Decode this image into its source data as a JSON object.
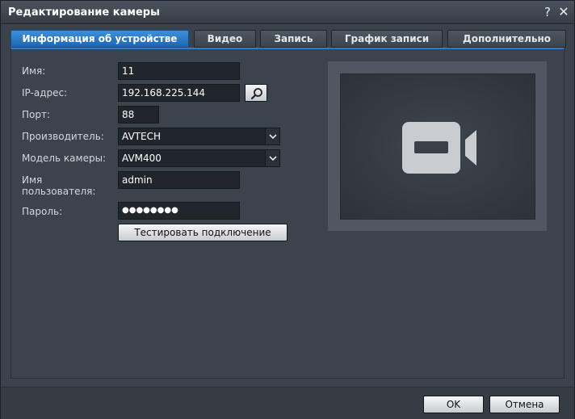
{
  "window": {
    "title": "Редактирование камеры",
    "help": "?",
    "close": "✕"
  },
  "tabs": [
    {
      "label": "Информация об устройстве",
      "active": true
    },
    {
      "label": "Видео",
      "active": false
    },
    {
      "label": "Запись",
      "active": false
    },
    {
      "label": "График записи",
      "active": false
    },
    {
      "label": "Дополнительно",
      "active": false
    }
  ],
  "form": {
    "name_label": "Имя:",
    "name_value": "11",
    "ip_label": "IP-адрес:",
    "ip_value": "192.168.225.144",
    "port_label": "Порт:",
    "port_value": "88",
    "vendor_label": "Производитель:",
    "vendor_value": "AVTECH",
    "model_label": "Модель камеры:",
    "model_value": "AVM400",
    "user_label_1": "Имя",
    "user_label_2": "пользователя:",
    "user_value": "admin",
    "password_label": "Пароль:",
    "password_value": "●●●●●●●●",
    "test_button": "Тестировать подключение"
  },
  "preview": {
    "icon": "video-camera-icon"
  },
  "footer": {
    "ok": "OK",
    "cancel": "Отмена"
  },
  "colors": {
    "accent": "#2f7ccc",
    "background": "#3a424b"
  }
}
